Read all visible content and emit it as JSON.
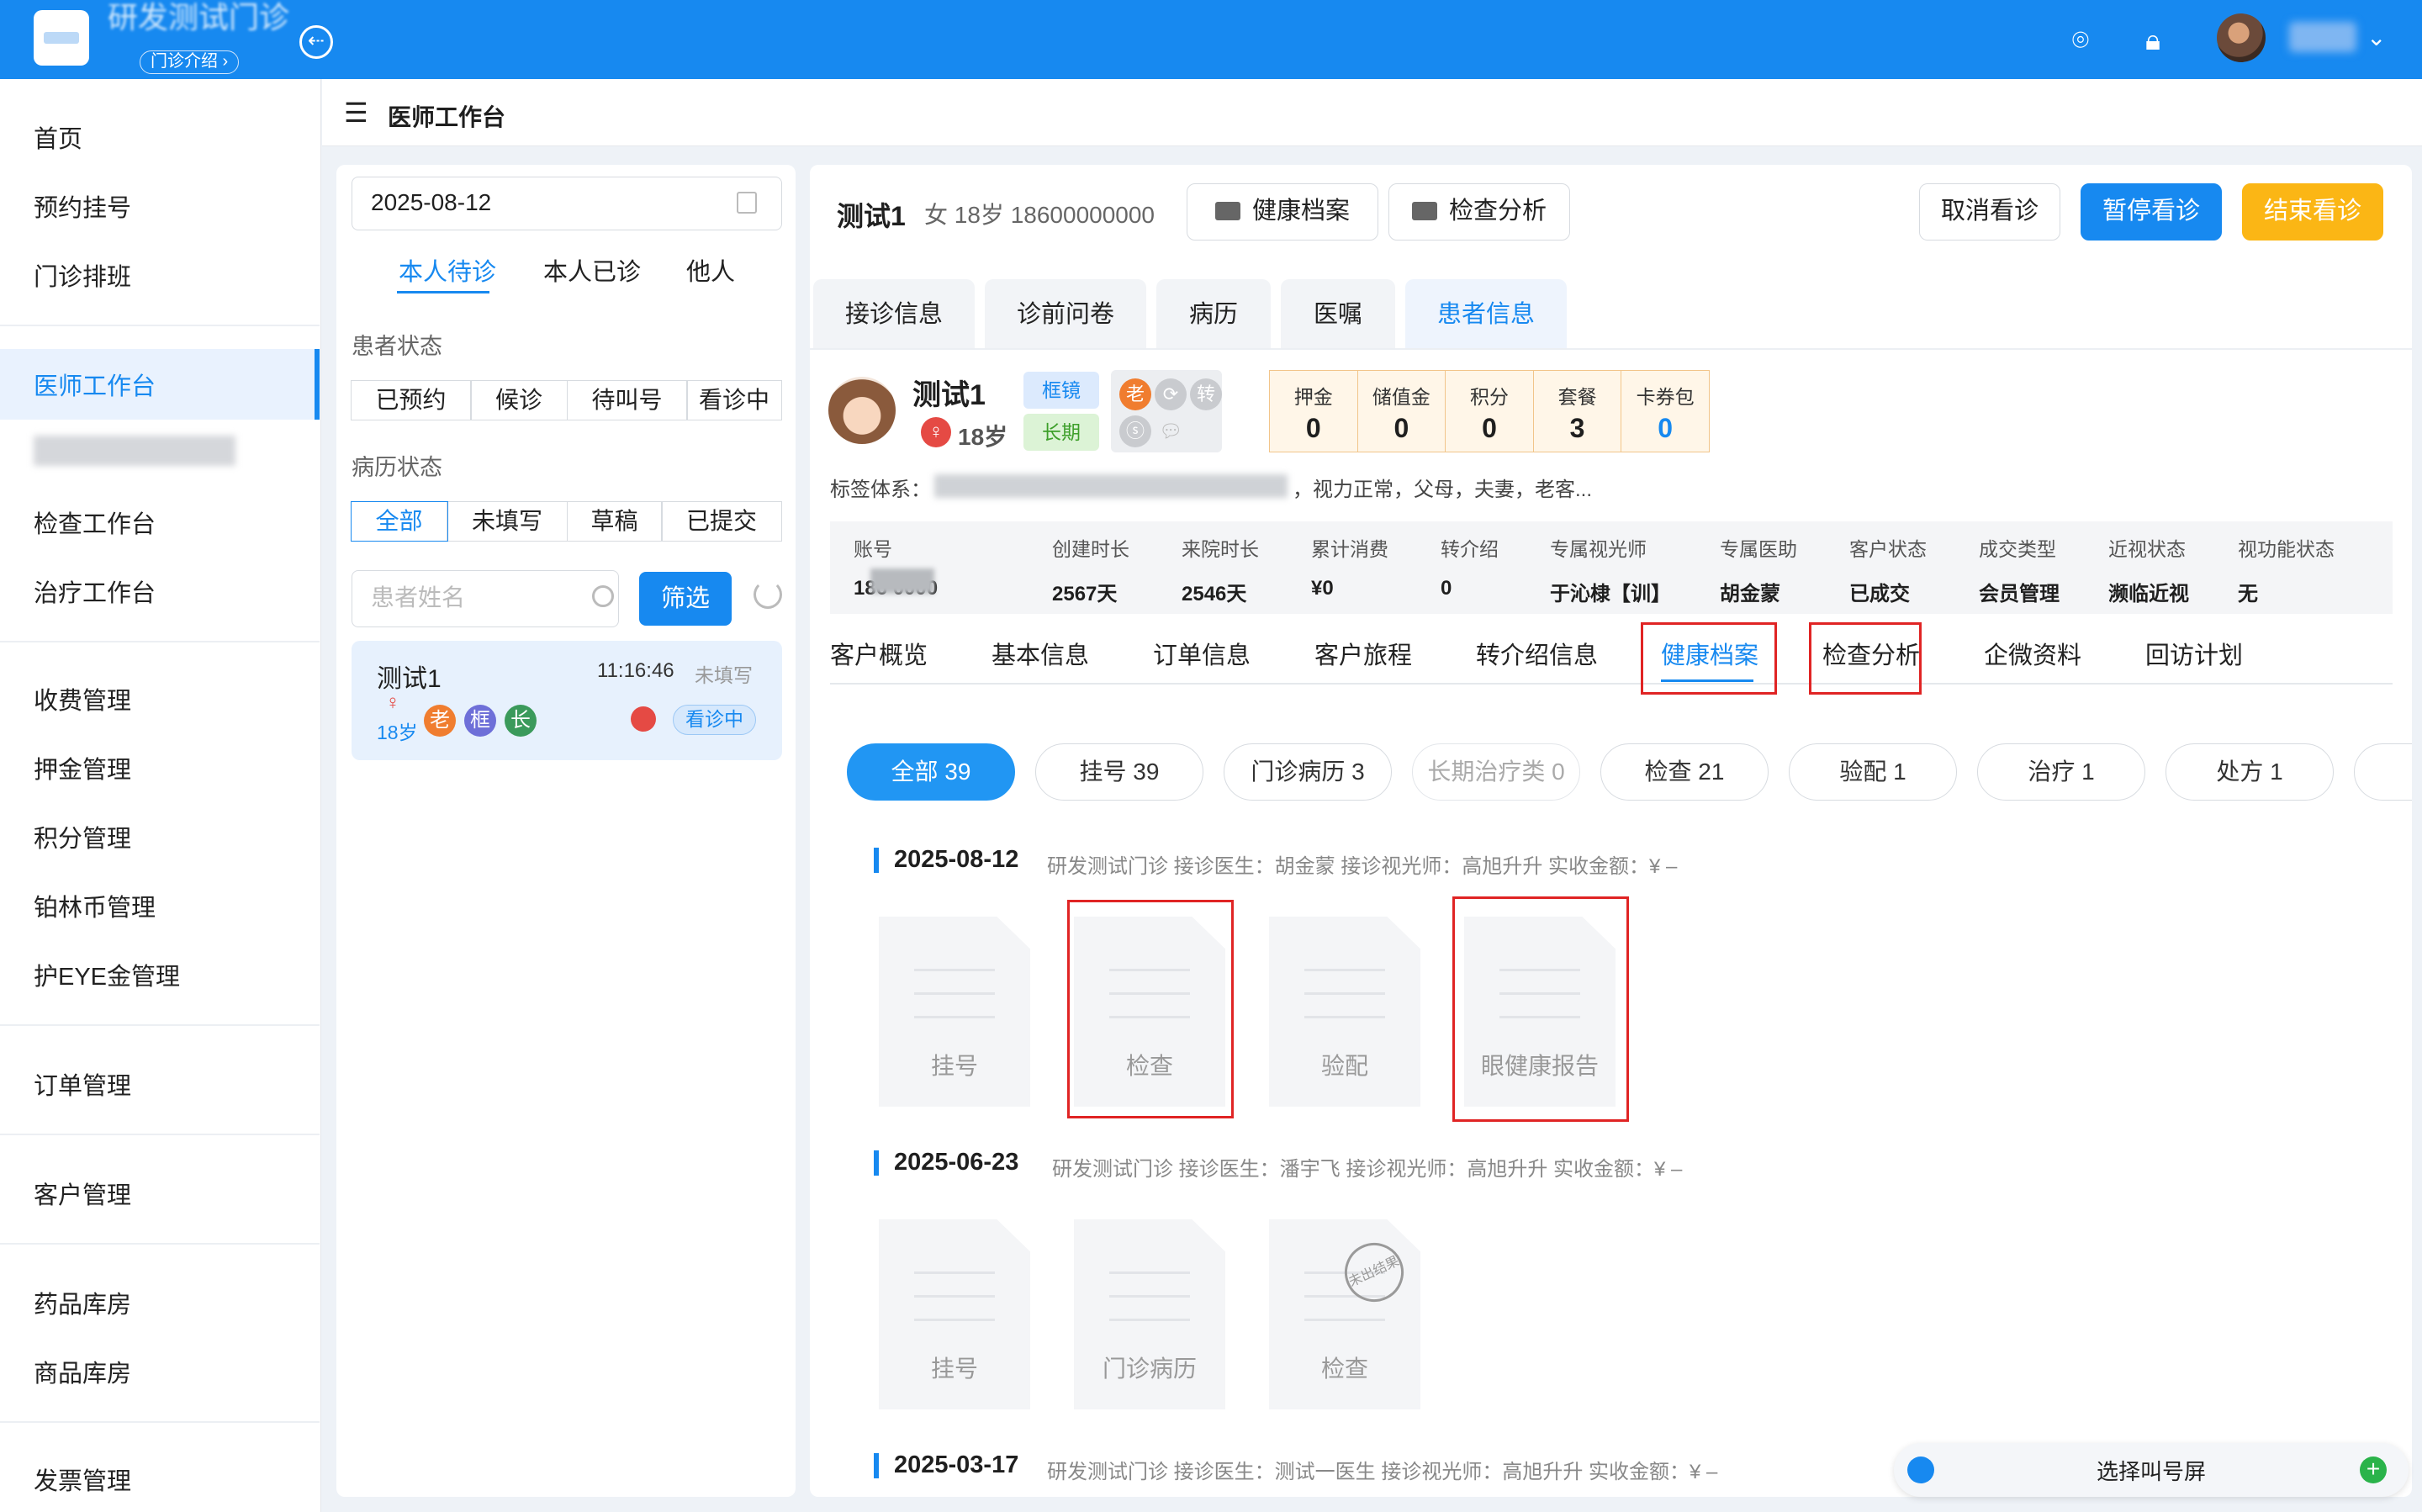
{
  "topbar": {
    "clinic": "研发测试门诊",
    "intro": "门诊介绍 ›",
    "user_chevron": "⌄"
  },
  "sidebar": {
    "items": [
      "首页",
      "预约挂号",
      "门诊排班",
      "医师工作台",
      "检查工作台",
      "治疗工作台",
      "收费管理",
      "押金管理",
      "积分管理",
      "铂林币管理",
      "护EYE金管理",
      "订单管理",
      "客户管理",
      "药品库房",
      "商品库房",
      "发票管理"
    ],
    "active": "医师工作台"
  },
  "header": {
    "title": "医师工作台"
  },
  "left": {
    "date": "2025-08-12",
    "tabs": [
      "本人待诊",
      "本人已诊",
      "他人"
    ],
    "patient_status_label": "患者状态",
    "patient_status": [
      "已预约",
      "候诊",
      "待叫号",
      "看诊中"
    ],
    "record_status_label": "病历状态",
    "record_status": [
      "全部",
      "未填写",
      "草稿",
      "已提交"
    ],
    "search_placeholder": "患者姓名",
    "filter": "筛选",
    "card": {
      "name": "测试1",
      "time": "11:16:46",
      "status": "未填写",
      "gender": "♀",
      "age": "18岁",
      "badges": [
        "老",
        "框",
        "长"
      ],
      "state": "看诊中"
    }
  },
  "main": {
    "name": "测试1",
    "meta": "女 18岁 18600000000",
    "btn_health": "健康档案",
    "btn_analysis": "检查分析",
    "btn_cancel": "取消看诊",
    "btn_pause": "暂停看诊",
    "btn_end": "结束看诊",
    "tabs": [
      "接诊信息",
      "诊前问卷",
      "病历",
      "医嘱",
      "患者信息"
    ],
    "active_tab": "患者信息",
    "patient": {
      "name": "测试1",
      "gender": "♀",
      "age": "18岁",
      "tag_frame": "框镜",
      "tag_long": "长期",
      "icons": [
        "老",
        "转"
      ]
    },
    "stats": [
      {
        "label": "押金",
        "value": "0"
      },
      {
        "label": "储值金",
        "value": "0"
      },
      {
        "label": "积分",
        "value": "0"
      },
      {
        "label": "套餐",
        "value": "3"
      },
      {
        "label": "卡券包",
        "value": "0"
      }
    ],
    "tagline_label": "标签体系：",
    "tagline_text": "，视力正常，父母，夫妻，老客...",
    "info": [
      {
        "label": "账号",
        "value": "186     0000"
      },
      {
        "label": "创建时长",
        "value": "2567天"
      },
      {
        "label": "来院时长",
        "value": "2546天"
      },
      {
        "label": "累计消费",
        "value": "¥0"
      },
      {
        "label": "转介绍",
        "value": "0"
      },
      {
        "label": "专属视光师",
        "value": "于沁棣【训】"
      },
      {
        "label": "专属医助",
        "value": "胡金蒙"
      },
      {
        "label": "客户状态",
        "value": "已成交"
      },
      {
        "label": "成交类型",
        "value": "会员管理"
      },
      {
        "label": "近视状态",
        "value": "濒临近视"
      },
      {
        "label": "视功能状态",
        "value": "无"
      }
    ],
    "subtabs": [
      "客户概览",
      "基本信息",
      "订单信息",
      "客户旅程",
      "转介绍信息",
      "健康档案",
      "检查分析",
      "企微资料",
      "回访计划"
    ],
    "active_subtab": "健康档案",
    "chips": [
      "全部 39",
      "挂号 39",
      "门诊病历 3",
      "长期治疗类 0",
      "检查 21",
      "验配 1",
      "治疗 1",
      "处方 1"
    ],
    "records": [
      {
        "date": "2025-08-12",
        "info": "研发测试门诊   接诊医生：胡金蒙   接诊视光师：高旭升升   实收金额：¥ –",
        "docs": [
          "挂号",
          "检查",
          "验配",
          "眼健康报告"
        ]
      },
      {
        "date": "2025-06-23",
        "info": "研发测试门诊   接诊医生：潘宇飞   接诊视光师：高旭升升   实收金额：¥ –",
        "docs": [
          "挂号",
          "门诊病历",
          "检查"
        ],
        "stamp": "未出结果"
      },
      {
        "date": "2025-03-17",
        "info": "研发测试门诊   接诊医生：测试一医生   接诊视光师：高旭升升   实收金额：¥ –"
      }
    ]
  },
  "callbar": {
    "label": "选择叫号屏"
  }
}
